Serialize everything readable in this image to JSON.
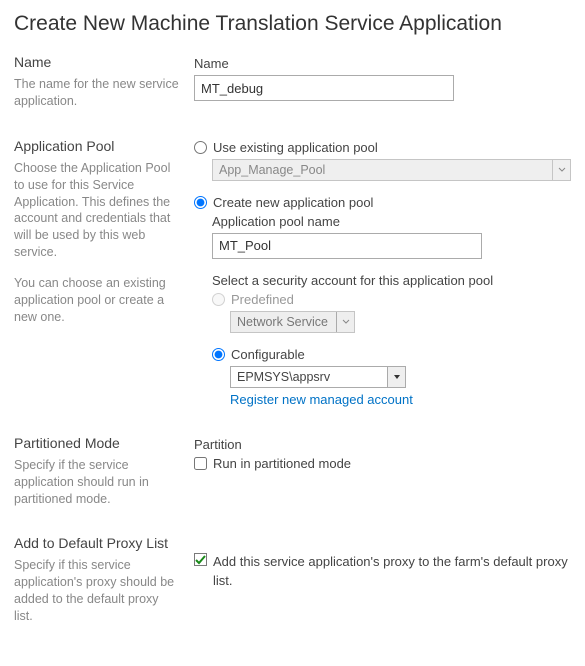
{
  "page_title": "Create New Machine Translation Service Application",
  "name_section": {
    "heading": "Name",
    "desc": "The name for the new service application.",
    "label": "Name",
    "value": "MT_debug"
  },
  "pool_section": {
    "heading": "Application Pool",
    "desc1": "Choose the Application Pool to use for this Service Application.  This defines the account and credentials that will be used by this web service.",
    "desc2": "You can choose an existing application pool or create a new one.",
    "use_existing_label": "Use existing application pool",
    "existing_selected": "App_Manage_Pool",
    "create_new_label": "Create new application pool",
    "pool_name_label": "Application pool name",
    "pool_name_value": "MT_Pool",
    "security_label": "Select a security account for this application pool",
    "predefined_label": "Predefined",
    "predefined_value": "Network Service",
    "configurable_label": "Configurable",
    "configurable_value": "EPMSYS\\appsrv",
    "register_link": "Register new managed account"
  },
  "partition_section": {
    "heading": "Partitioned Mode",
    "desc": "Specify if the service application should run in partitioned mode.",
    "label": "Partition",
    "checkbox_label": "Run in partitioned mode",
    "checked": false
  },
  "proxy_section": {
    "heading": "Add to Default Proxy List",
    "desc": "Specify if this service application's proxy should be added to the default proxy list.",
    "checkbox_label": "Add this service application's proxy to the farm's default proxy list.",
    "checked": true
  }
}
